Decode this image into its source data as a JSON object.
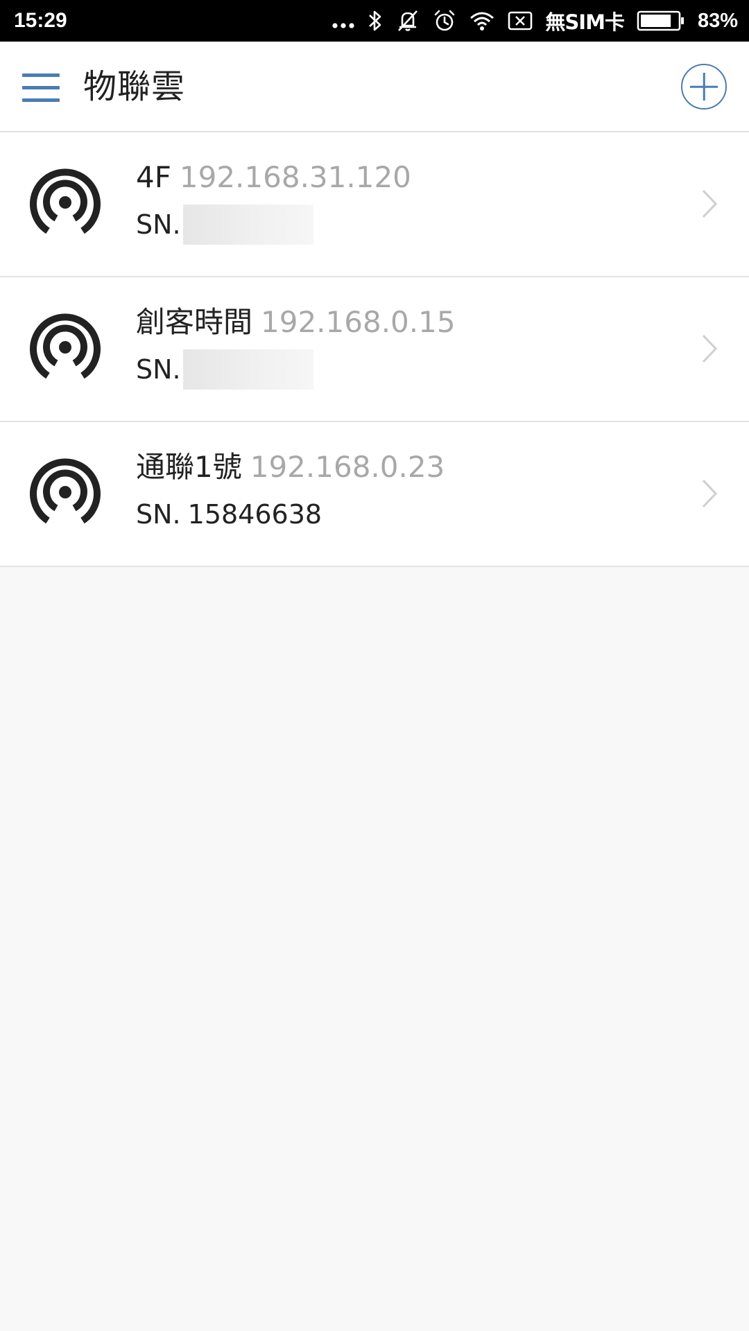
{
  "status_bar": {
    "time": "15:29",
    "sim_status": "無SIM卡",
    "battery_percent": "83%",
    "battery_level": 0.83,
    "icons": [
      "more-dots-icon",
      "bluetooth-icon",
      "vibrate-off-icon",
      "alarm-icon",
      "wifi-icon",
      "no-sim-icon",
      "battery-icon"
    ]
  },
  "app_bar": {
    "title": "物聯雲",
    "menu_icon": "hamburger-menu-icon",
    "add_icon": "add-circle-icon"
  },
  "devices": [
    {
      "name": "4F",
      "ip": "192.168.31.120",
      "sn_label": "SN.",
      "sn": "",
      "sn_redacted": true,
      "icon": "broadcast-icon"
    },
    {
      "name": "創客時間",
      "ip": "192.168.0.15",
      "sn_label": "SN.",
      "sn": "",
      "sn_redacted": true,
      "icon": "broadcast-icon"
    },
    {
      "name": "通聯1號",
      "ip": "192.168.0.23",
      "sn_label": "SN.",
      "sn": "15846638",
      "sn_redacted": false,
      "icon": "broadcast-icon"
    }
  ],
  "colors": {
    "accent": "#4a7db4",
    "status_bar_bg": "#000000",
    "page_bg": "#f8f8f8",
    "row_bg": "#ffffff",
    "ip_text": "#a8a8a8",
    "divider": "#e2e2e2"
  }
}
